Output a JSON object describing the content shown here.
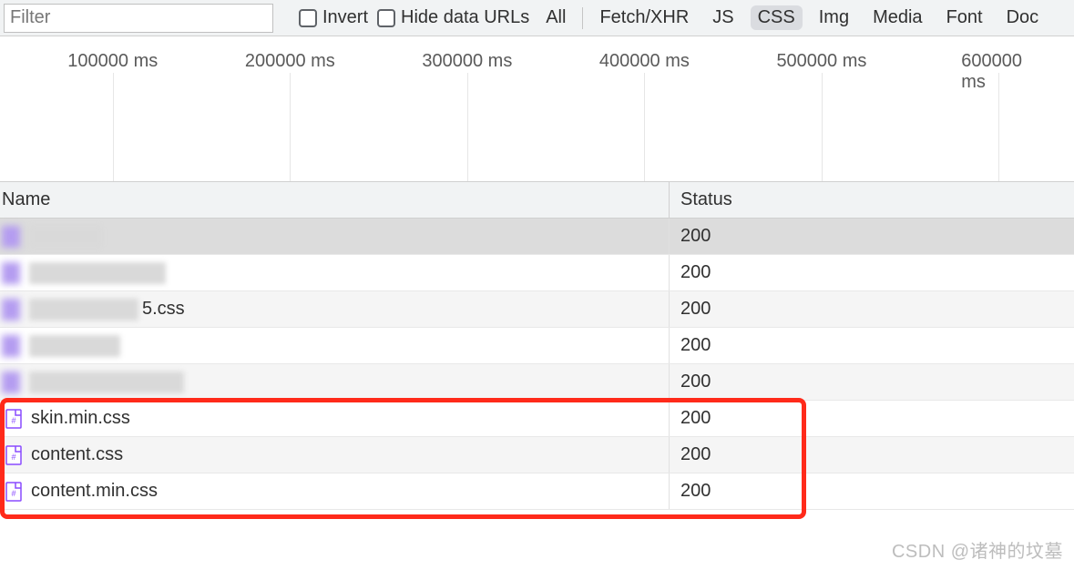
{
  "toolbar": {
    "filter_placeholder": "Filter",
    "invert_label": "Invert",
    "hide_data_urls_label": "Hide data URLs",
    "filters": [
      {
        "id": "all",
        "label": "All",
        "active": false
      },
      {
        "id": "fetch",
        "label": "Fetch/XHR",
        "active": false
      },
      {
        "id": "js",
        "label": "JS",
        "active": false
      },
      {
        "id": "css",
        "label": "CSS",
        "active": true
      },
      {
        "id": "img",
        "label": "Img",
        "active": false
      },
      {
        "id": "media",
        "label": "Media",
        "active": false
      },
      {
        "id": "font",
        "label": "Font",
        "active": false
      },
      {
        "id": "doc",
        "label": "Doc",
        "active": false
      }
    ]
  },
  "timeline": {
    "ticks": [
      {
        "label": "100000 ms",
        "pos_pct": 10.5
      },
      {
        "label": "200000 ms",
        "pos_pct": 27
      },
      {
        "label": "300000 ms",
        "pos_pct": 43.5
      },
      {
        "label": "400000 ms",
        "pos_pct": 60
      },
      {
        "label": "500000 ms",
        "pos_pct": 76.5
      },
      {
        "label": "600000 ms",
        "pos_pct": 93
      }
    ]
  },
  "table": {
    "headers": {
      "name": "Name",
      "status": "Status"
    },
    "rows": [
      {
        "name_redacted": true,
        "blur_w": 80,
        "suffix": "",
        "status": "200",
        "selected": true
      },
      {
        "name_redacted": true,
        "blur_w": 150,
        "suffix": "",
        "status": "200",
        "selected": false
      },
      {
        "name_redacted": true,
        "blur_w": 120,
        "suffix": "5.css",
        "status": "200",
        "selected": false
      },
      {
        "name_redacted": true,
        "blur_w": 100,
        "suffix": "",
        "status": "200",
        "selected": false
      },
      {
        "name_redacted": true,
        "blur_w": 170,
        "suffix": "",
        "status": "200",
        "selected": false
      },
      {
        "name_redacted": false,
        "name": "skin.min.css",
        "status": "200",
        "selected": false
      },
      {
        "name_redacted": false,
        "name": "content.css",
        "status": "200",
        "selected": false
      },
      {
        "name_redacted": false,
        "name": "content.min.css",
        "status": "200",
        "selected": false
      }
    ]
  },
  "watermark": "CSDN @诸神的坟墓"
}
